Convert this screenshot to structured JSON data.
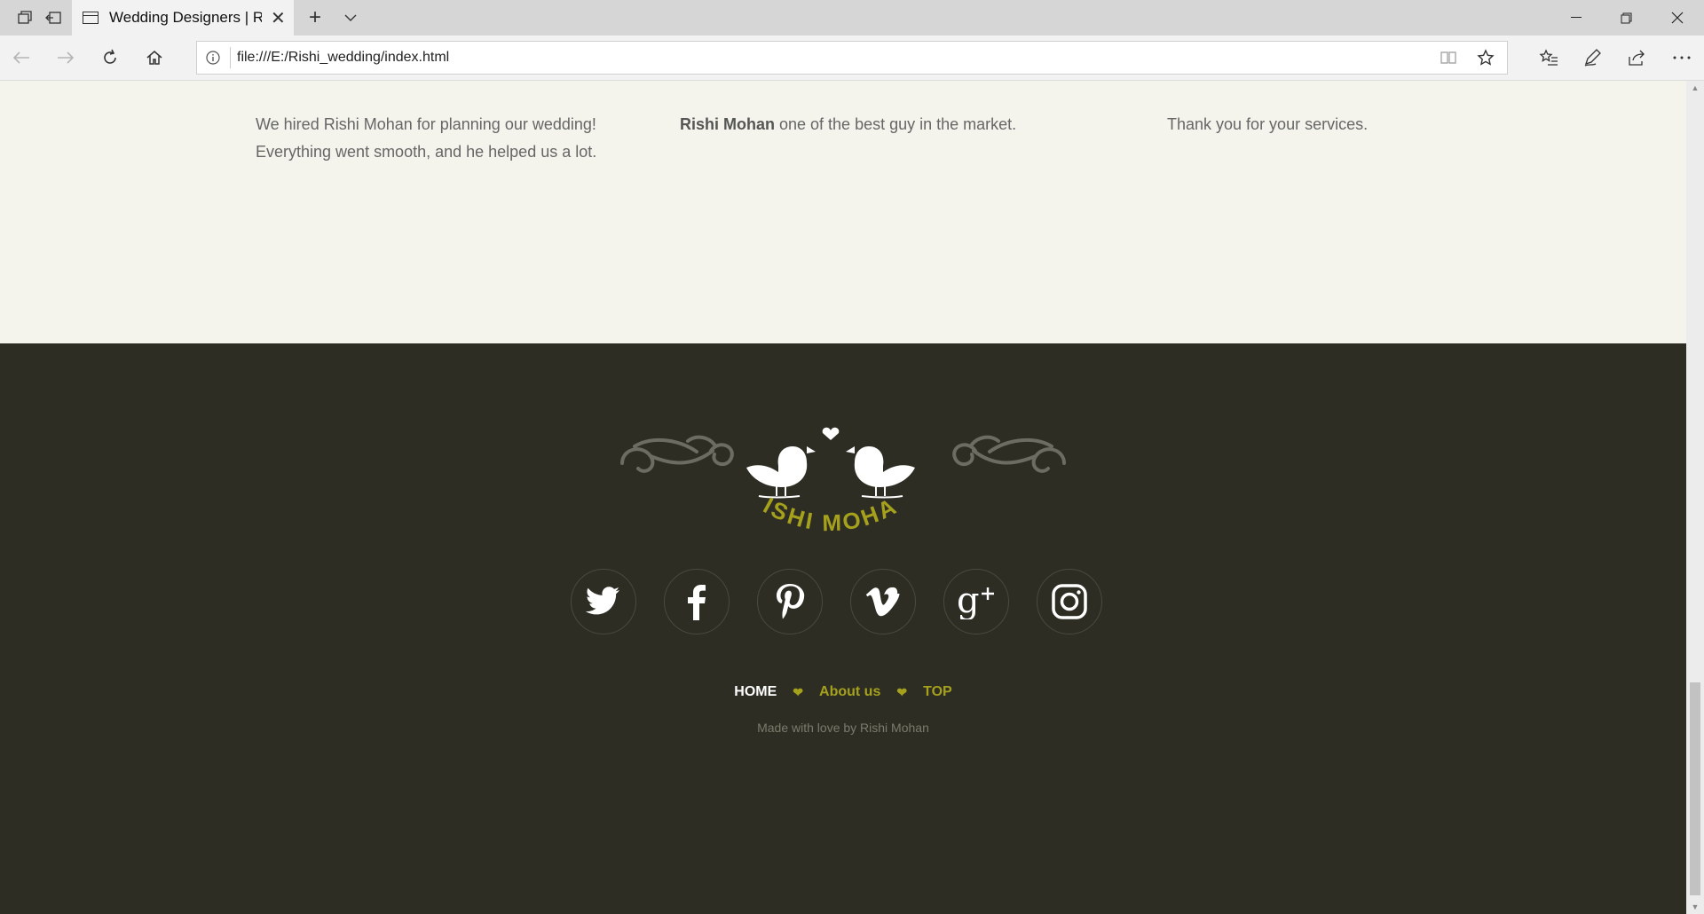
{
  "browser": {
    "tab_title": "Wedding Designers | Rishi Mohan",
    "new_tab_symbol": "+",
    "url": "file:///E:/Rishi_wedding/index.html"
  },
  "testimonials": [
    {
      "line1": "We hired Rishi Mohan for planning our wedding!",
      "line2": "Everything went smooth, and he helped us a lot."
    },
    {
      "name": "Rishi Mohan",
      "text": " one of the best guy in the market."
    },
    {
      "text": "Thank you for your services."
    }
  ],
  "footer": {
    "logo_text": "RISHI MOHAN",
    "social": [
      "twitter-icon",
      "facebook-icon",
      "pinterest-icon",
      "vimeo-icon",
      "google-plus-icon",
      "instagram-icon"
    ],
    "nav": {
      "home": "HOME",
      "about": "About us",
      "top": "TOP"
    },
    "credit": "Made with love by Rishi Mohan"
  },
  "colors": {
    "footer_bg": "#2d2d24",
    "section_bg": "#f4f4ec",
    "accent": "#a5a11d"
  }
}
